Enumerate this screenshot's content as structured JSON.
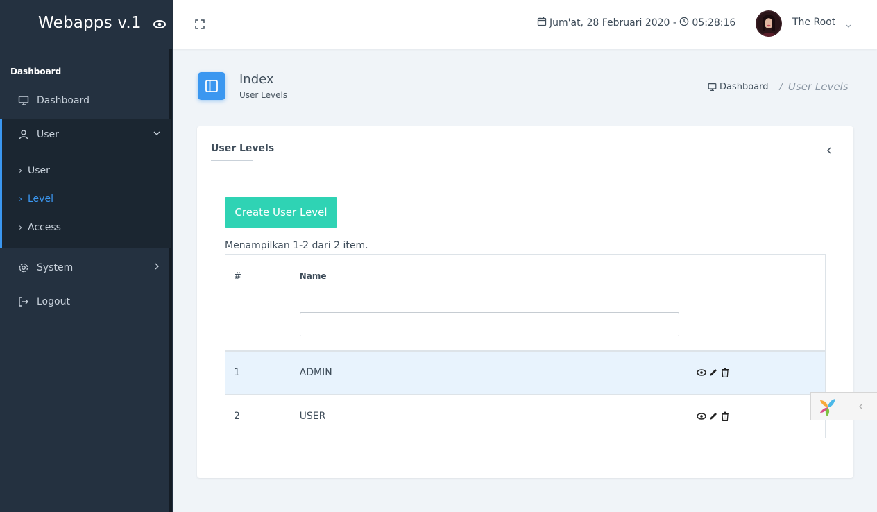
{
  "brand": {
    "name": "Webapps v.1"
  },
  "sidebar": {
    "section_label": "Dashboard",
    "items": [
      {
        "label": "Dashboard",
        "icon": "monitor-icon"
      },
      {
        "label": "User",
        "icon": "user-icon"
      },
      {
        "label": "System",
        "icon": "gear-icon"
      },
      {
        "label": "Logout",
        "icon": "logout-icon"
      }
    ],
    "user_submenu": [
      {
        "label": "User"
      },
      {
        "label": "Level",
        "active": true
      },
      {
        "label": "Access"
      }
    ],
    "chevron": "›"
  },
  "topbar": {
    "datetime_date": "Jum'at, 28 Februari 2020 - ",
    "datetime_time": "05:28:16",
    "user_name": "The Root"
  },
  "page": {
    "title": "Index",
    "subtitle": "User Levels",
    "breadcrumb_home": "Dashboard",
    "breadcrumb_sep": "/",
    "breadcrumb_current": "User Levels"
  },
  "card": {
    "title": "User Levels",
    "create_button": "Create User Level",
    "summary": "Menampilkan 1-2 dari 2 item."
  },
  "table": {
    "headers": {
      "num": "#",
      "name": "Name",
      "actions": ""
    },
    "filter_placeholder": "",
    "rows": [
      {
        "num": "1",
        "name": "ADMIN"
      },
      {
        "num": "2",
        "name": "USER"
      }
    ]
  },
  "colors": {
    "sidebar_bg": "#243140",
    "accent": "#3b97f0",
    "create_button": "#2fd3b4",
    "row_highlight": "#e8f3fd"
  }
}
